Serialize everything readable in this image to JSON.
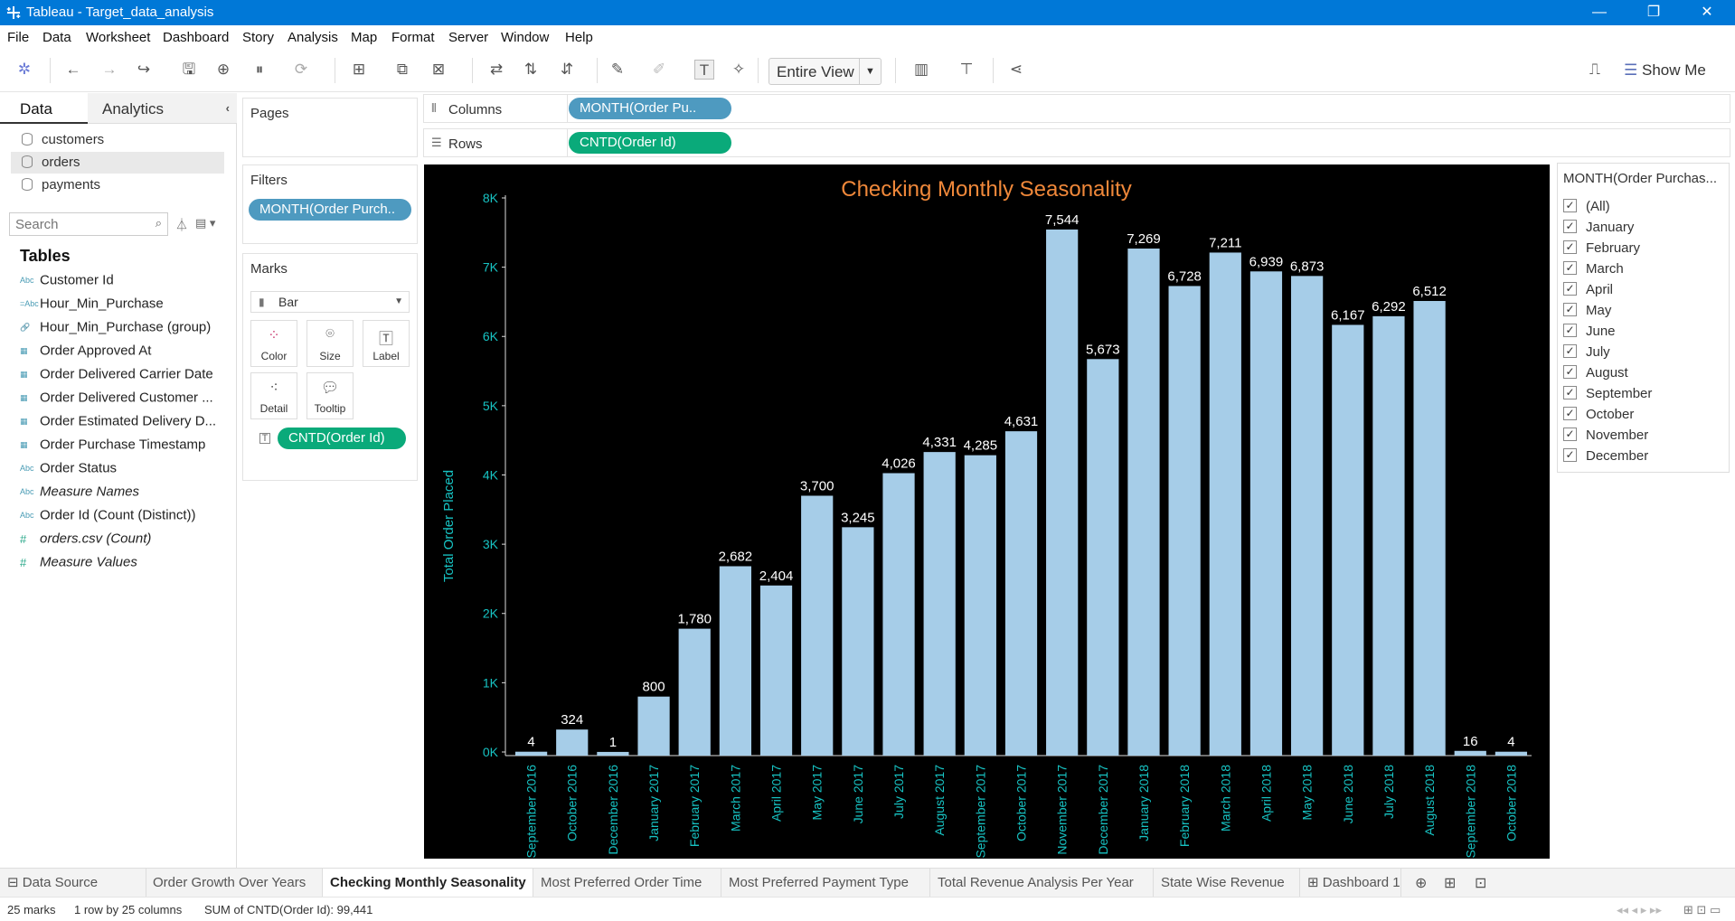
{
  "window": {
    "title": "Tableau - Target_data_analysis",
    "minimize": "—",
    "restore": "❐",
    "close": "✕"
  },
  "menu": [
    "File",
    "Data",
    "Worksheet",
    "Dashboard",
    "Story",
    "Analysis",
    "Map",
    "Format",
    "Server",
    "Window",
    "Help"
  ],
  "toolbar": {
    "fit_mode": "Entire View",
    "show_me": "Show Me"
  },
  "data_pane": {
    "tabs": {
      "data": "Data",
      "analytics": "Analytics"
    },
    "sources": [
      {
        "label": "customers"
      },
      {
        "label": "orders"
      },
      {
        "label": "payments"
      }
    ],
    "search_placeholder": "Search",
    "tables_heading": "Tables",
    "fields": [
      {
        "icon": "Abc",
        "label": "Customer Id"
      },
      {
        "icon": "=Abc",
        "label": "Hour_Min_Purchase"
      },
      {
        "icon": "🔗",
        "label": "Hour_Min_Purchase (group)"
      },
      {
        "icon": "▦",
        "label": "Order Approved At"
      },
      {
        "icon": "▦",
        "label": "Order Delivered Carrier Date"
      },
      {
        "icon": "▦",
        "label": "Order Delivered Customer ..."
      },
      {
        "icon": "▦",
        "label": "Order Estimated Delivery D..."
      },
      {
        "icon": "▦",
        "label": "Order Purchase Timestamp"
      },
      {
        "icon": "Abc",
        "label": "Order Status"
      },
      {
        "icon": "Abc",
        "label": "Measure Names"
      },
      {
        "icon": "Abc",
        "label": "Order Id (Count (Distinct))"
      },
      {
        "icon": "#",
        "label": "orders.csv (Count)"
      },
      {
        "icon": "#",
        "label": "Measure Values"
      }
    ]
  },
  "shelves": {
    "pages": "Pages",
    "filters": "Filters",
    "filter_pill": "MONTH(Order Purch..",
    "marks": "Marks",
    "mark_type": "Bar",
    "mark_buttons": [
      "Color",
      "Size",
      "Label",
      "Detail",
      "Tooltip"
    ],
    "marks_pill": "CNTD(Order Id)",
    "columns_label": "Columns",
    "columns_pill": "MONTH(Order Pu..",
    "rows_label": "Rows",
    "rows_pill": "CNTD(Order Id)"
  },
  "legend": {
    "title": "MONTH(Order Purchas...",
    "items": [
      "(All)",
      "January",
      "February",
      "March",
      "April",
      "May",
      "June",
      "July",
      "August",
      "September",
      "October",
      "November",
      "December"
    ]
  },
  "chart_data": {
    "type": "bar",
    "title": "Checking Monthly Seasonality",
    "ylabel": "Total Order Placed",
    "xlabel": "",
    "ylim": [
      0,
      8300
    ],
    "yticks": [
      "0K",
      "1K",
      "2K",
      "3K",
      "4K",
      "5K",
      "6K",
      "7K",
      "8K"
    ],
    "categories": [
      "September 2016",
      "October 2016",
      "December 2016",
      "January 2017",
      "February 2017",
      "March 2017",
      "April 2017",
      "May 2017",
      "June 2017",
      "July 2017",
      "August 2017",
      "September 2017",
      "October 2017",
      "November 2017",
      "December 2017",
      "January 2018",
      "February 2018",
      "March 2018",
      "April 2018",
      "May 2018",
      "June 2018",
      "July 2018",
      "August 2018",
      "September 2018",
      "October 2018"
    ],
    "values": [
      4,
      324,
      1,
      800,
      1780,
      2682,
      2404,
      3700,
      3245,
      4026,
      4331,
      4285,
      4631,
      7544,
      5673,
      7269,
      6728,
      7211,
      6939,
      6873,
      6167,
      6292,
      6512,
      16,
      4
    ],
    "labels": [
      "4",
      "324",
      "1",
      "800",
      "1,780",
      "2,682",
      "2,404",
      "3,700",
      "3,245",
      "4,026",
      "4,331",
      "4,285",
      "4,631",
      "7,544",
      "5,673",
      "7,269",
      "6,728",
      "7,211",
      "6,939",
      "6,873",
      "6,167",
      "6,292",
      "6,512",
      "16",
      "4"
    ],
    "colors": {
      "bar": "#a6cde8",
      "axis_text": "#17c3c3",
      "title": "#f0883a",
      "label": "#ffffff",
      "background": "#000000"
    },
    "grid": false
  },
  "sheet_tabs": {
    "data_source": "Data Source",
    "sheets": [
      "Order Growth Over Years",
      "Checking Monthly Seasonality",
      "Most Preferred Order Time",
      "Most Preferred Payment Type",
      "Total Revenue Analysis Per Year",
      "State Wise Revenue",
      "Dashboard 1"
    ],
    "active": "Checking Monthly Seasonality"
  },
  "status": {
    "marks": "25 marks",
    "dims": "1 row by 25 columns",
    "sum": "SUM of CNTD(Order Id): 99,441"
  }
}
